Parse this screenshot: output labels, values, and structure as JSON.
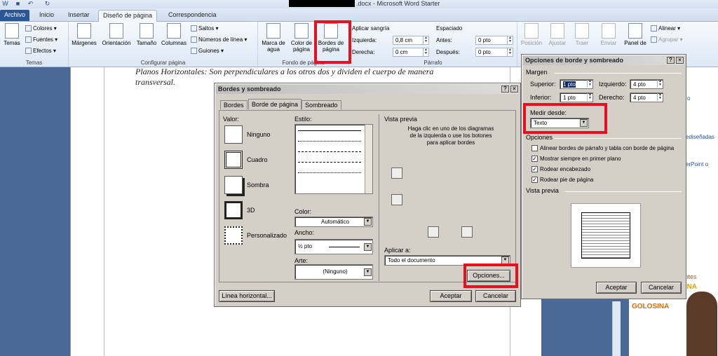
{
  "window": {
    "title": ".docx - Microsoft Word Starter"
  },
  "tabs": [
    "Archivo",
    "Inicio",
    "Insertar",
    "Diseño de página",
    "Correspondencia"
  ],
  "ribbon": {
    "temas_group": {
      "temas": "Temas",
      "colores": "Colores",
      "fuentes": "Fuentes",
      "efectos": "Efectos",
      "label": "Temas"
    },
    "config_group": {
      "margenes": "Márgenes",
      "orientacion": "Orientación",
      "tamano": "Tamaño",
      "columnas": "Columnas",
      "saltos": "Saltos",
      "numeros": "Números de línea",
      "guiones": "Guiones",
      "label": "Configurar página"
    },
    "fondo_group": {
      "marca": "Marca de agua",
      "color": "Color de página",
      "bordes": "Bordes de página",
      "label": "Fondo de página"
    },
    "parrafo_group": {
      "sangria": "Aplicar sangría",
      "izquierda": "Izquierda:",
      "izquierda_val": "0,8 cm",
      "derecha": "Derecha:",
      "derecha_val": "0 cm",
      "espaciado": "Espaciado",
      "antes": "Antes:",
      "antes_val": "0 pto",
      "despues": "Después:",
      "despues_val": "0 pto",
      "label": "Párrafo"
    },
    "organizar_group": {
      "posicion": "Posición",
      "ajustar": "Ajustar",
      "traer": "Traer",
      "enviar": "Enviar",
      "panel": "Panel de",
      "alinear": "Alinear",
      "agrupar": "Agrupar"
    }
  },
  "document": {
    "line1": "Planos Horizontales: Son perpendiculares a los otros dos y dividen el cuerpo de manera",
    "line2": "transversal."
  },
  "side_links": [
    "o",
    "ediseñadas",
    "erPoint o"
  ],
  "ad": {
    "line1": "pacientes",
    "line2": "NZANA",
    "line3": "GOLOSINA"
  },
  "borders_dialog": {
    "title": "Bordes y sombreado",
    "tabs": [
      "Bordes",
      "Borde de página",
      "Sombreado"
    ],
    "valor": "Valor:",
    "settings": [
      "Ninguno",
      "Cuadro",
      "Sombra",
      "3D",
      "Personalizado"
    ],
    "estilo": "Estilo:",
    "color_label": "Color:",
    "color_val": "Automático",
    "ancho_label": "Ancho:",
    "ancho_val": "½ pto",
    "arte_label": "Arte:",
    "arte_val": "(Ninguno)",
    "vista": "Vista previa",
    "vista_hint": "Haga clic en uno de los diagramas de la izquierda o use los botones para aplicar bordes",
    "aplicar_label": "Aplicar a:",
    "aplicar_val": "Todo el documento",
    "opciones": "Opciones...",
    "linea": "Línea horizontal...",
    "aceptar": "Aceptar",
    "cancelar": "Cancelar"
  },
  "options_dialog": {
    "title": "Opciones de borde y sombreado",
    "margen": "Margen",
    "superior": "Superior:",
    "superior_val": "1 pto",
    "izquierdo": "Izquierdo:",
    "izquierdo_val": "4 pto",
    "inferior": "Inferior:",
    "inferior_val": "1 pto",
    "derecho": "Derecho:",
    "derecho_val": "4 pto",
    "medir": "Medir desde:",
    "medir_val": "Texto",
    "opciones": "Opciones",
    "checks": [
      {
        "label": "Alinear bordes de párrafo y tabla con borde de página",
        "checked": false
      },
      {
        "label": "Mostrar siempre en primer plano",
        "checked": true
      },
      {
        "label": "Rodear encabezado",
        "checked": true
      },
      {
        "label": "Rodear pie de página",
        "checked": true
      }
    ],
    "vista": "Vista previa",
    "aceptar": "Aceptar",
    "cancelar": "Cancelar"
  },
  "accent": {
    "highlight": "#e8101f",
    "tab": "#2b5797"
  }
}
